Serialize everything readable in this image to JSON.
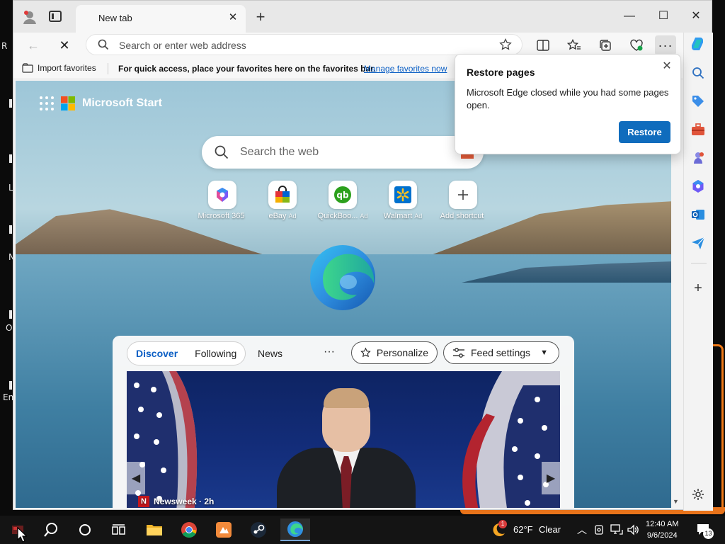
{
  "desktop": {
    "fragments": [
      "R",
      "L",
      "N",
      "O",
      "En"
    ]
  },
  "browser": {
    "tab": {
      "title": "New tab"
    },
    "address": {
      "placeholder": "Search or enter web address"
    },
    "favorites_bar": {
      "import_label": "Import favorites",
      "message": "For quick access, place your favorites here on the favorites bar.",
      "manage_link": "Manage favorites now"
    }
  },
  "newtab": {
    "brand": "Microsoft Start",
    "search_placeholder": "Search the web",
    "shortcuts": [
      {
        "label": "Microsoft 365",
        "ad": ""
      },
      {
        "label": "eBay",
        "ad": "Ad"
      },
      {
        "label": "QuickBoo...",
        "ad": "Ad"
      },
      {
        "label": "Walmart",
        "ad": "Ad"
      },
      {
        "label": "Add shortcut",
        "ad": ""
      }
    ],
    "feed": {
      "tabs": [
        "Discover",
        "Following"
      ],
      "active_tab": "Discover",
      "news_label": "News",
      "more_label": "···",
      "personalize_label": "Personalize",
      "feed_settings_label": "Feed settings",
      "hero_source": "Newsweek · 2h",
      "hero_source_icon": "N"
    }
  },
  "popup": {
    "title": "Restore pages",
    "body": "Microsoft Edge closed while you had some pages open.",
    "button": "Restore"
  },
  "taskbar": {
    "weather_temp": "62°F",
    "weather_condition": "Clear",
    "time": "12:40 AM",
    "date": "9/6/2024",
    "notification_count": "13",
    "weather_alert": "1"
  },
  "colors": {
    "accent": "#0f6cbd",
    "link": "#0a5ec4"
  }
}
